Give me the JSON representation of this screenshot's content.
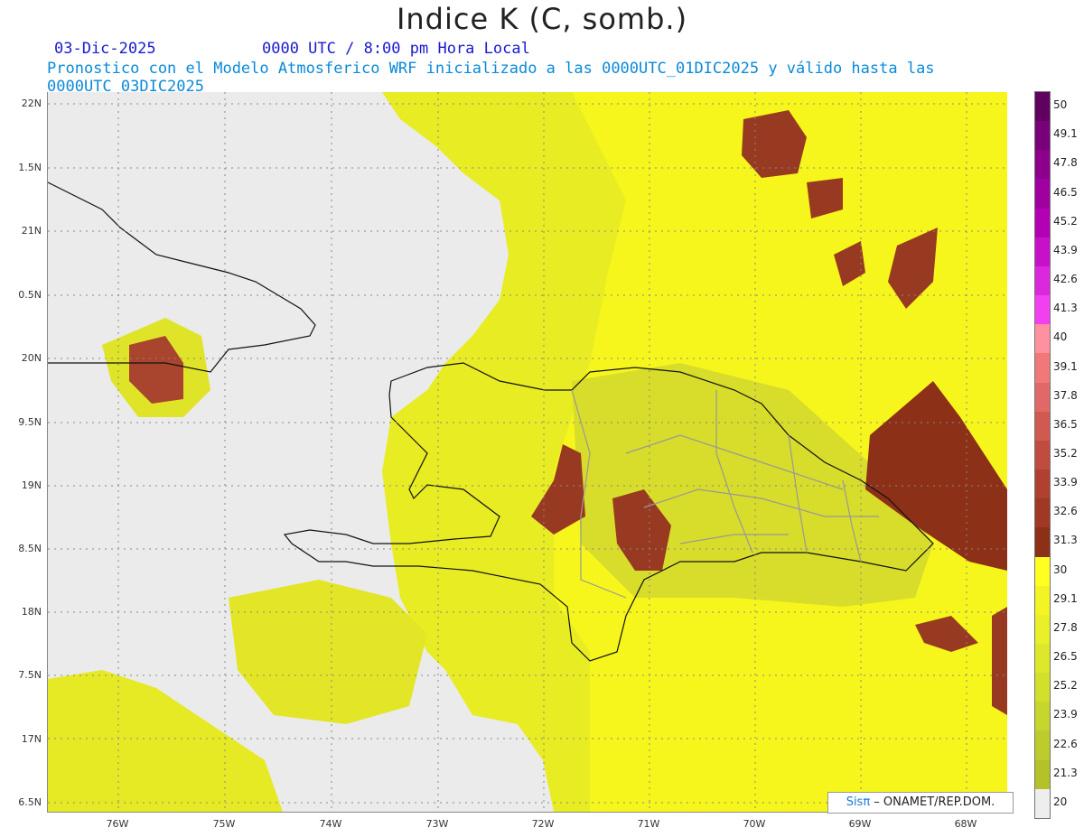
{
  "title": "Indice K (C, somb.)",
  "subtitle_date": "03-Dic-2025",
  "subtitle_time": "0000 UTC / 8:00 pm Hora Local",
  "subtitle_model": "Pronostico con el Modelo Atmosferico WRF inicializado a las 0000UTC_01DIC2025 y válido hasta las  0000UTC_03DIC2025",
  "lat_labels": [
    "22N",
    "1.5N",
    "21N",
    "0.5N",
    "20N",
    "9.5N",
    "19N",
    "8.5N",
    "18N",
    "7.5N",
    "17N",
    "6.5N"
  ],
  "lon_labels": [
    "76W",
    "75W",
    "74W",
    "73W",
    "72W",
    "71W",
    "70W",
    "69W",
    "68W"
  ],
  "colorbar": {
    "labels": [
      "50",
      "49.1",
      "47.8",
      "46.5",
      "45.2",
      "43.9",
      "42.6",
      "41.3",
      "40",
      "39.1",
      "37.8",
      "36.5",
      "35.2",
      "33.9",
      "32.6",
      "31.3",
      "30",
      "29.1",
      "27.8",
      "26.5",
      "25.2",
      "23.9",
      "22.6",
      "21.3",
      "20"
    ],
    "colors": [
      "#600060",
      "#780078",
      "#8c008c",
      "#a000a0",
      "#b400b4",
      "#c810c8",
      "#dc28dc",
      "#f040f0",
      "#ff90a0",
      "#f07878",
      "#e06868",
      "#d05a50",
      "#c04c40",
      "#b04030",
      "#a03826",
      "#8c3018",
      "#ffff22",
      "#f4f424",
      "#eaf028",
      "#dde82a",
      "#d2e02c",
      "#c6d62c",
      "#bccc2c",
      "#b4c22a",
      "#eeeeee"
    ]
  },
  "credit": {
    "sis": "Sisπ",
    "rest": " – ONAMET/REP.DOM."
  }
}
